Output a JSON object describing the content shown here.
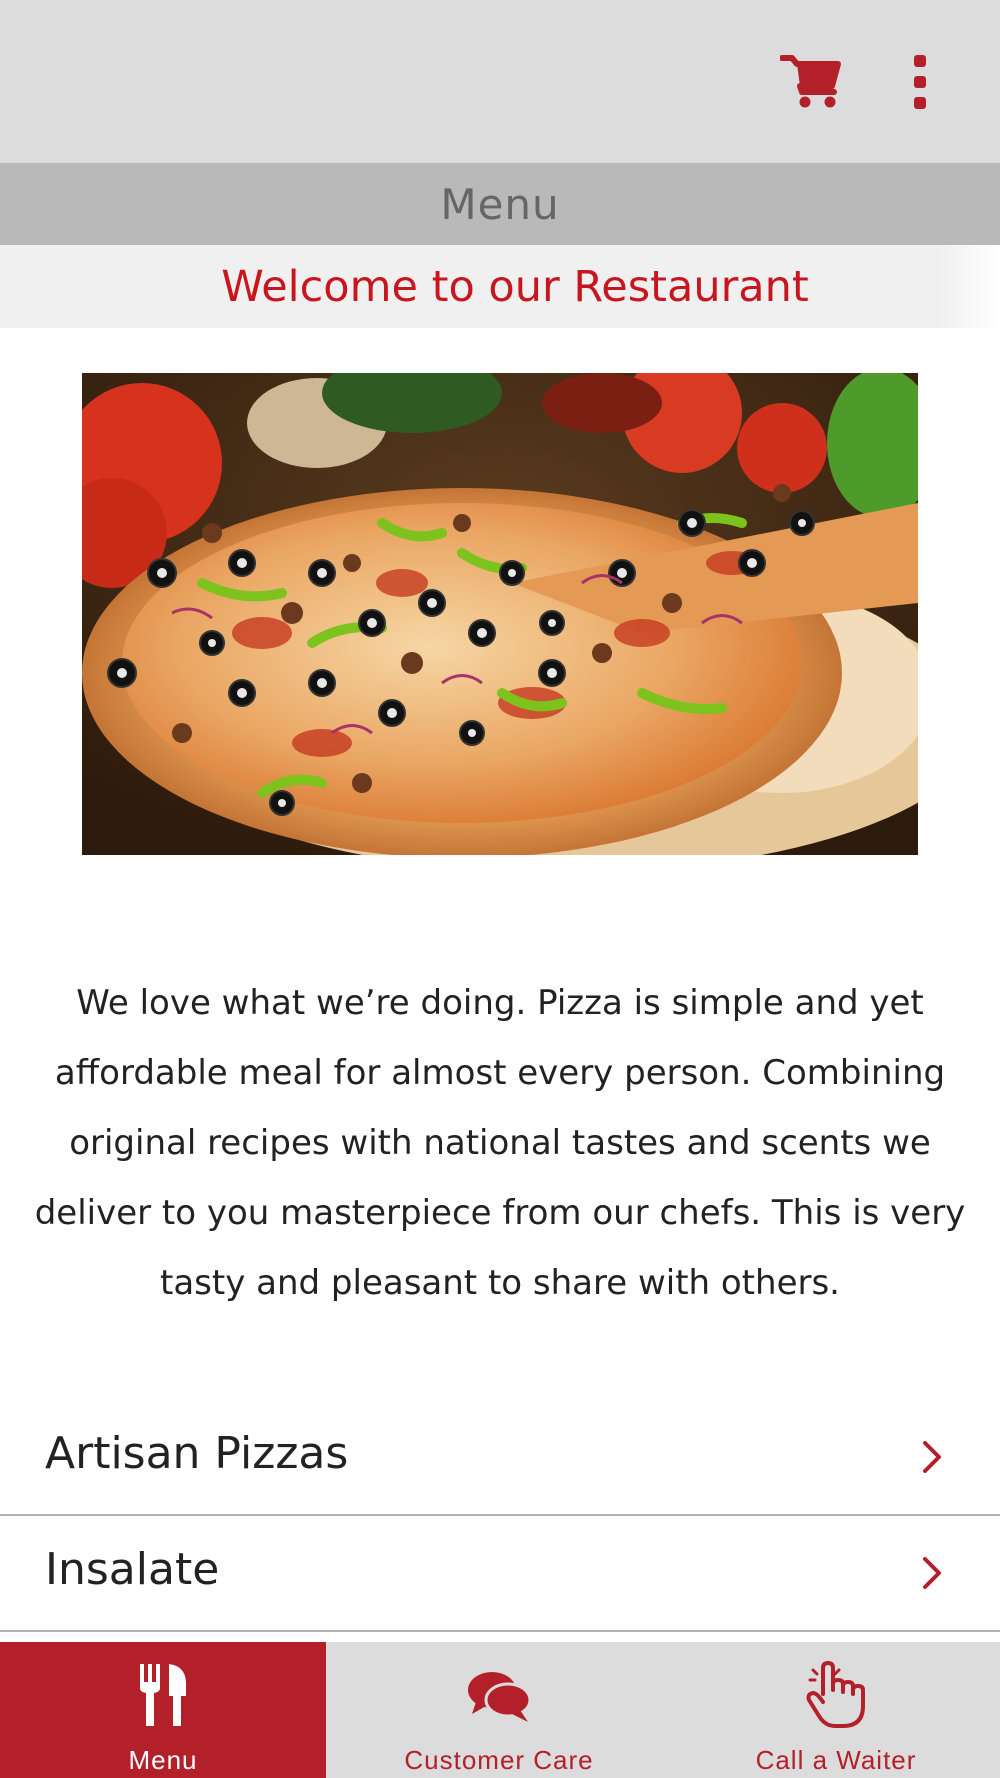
{
  "appbar": {
    "cart_icon": "shopping-cart-icon",
    "more_icon": "more-vertical-icon"
  },
  "header": {
    "title": "Menu"
  },
  "welcome": {
    "text": "Welcome to our Restaurant"
  },
  "hero": {
    "image": "pizza-photo"
  },
  "description": "We love what we’re doing. Pizza is simple and yet affordable meal for almost every person. Combining original recipes with national tastes and scents we deliver to you masterpiece from our chefs. This is very tasty and pleasant to share with others.",
  "categories": [
    {
      "label": "Artisan Pizzas"
    },
    {
      "label": "Insalate"
    }
  ],
  "tabs": [
    {
      "label": "Menu",
      "icon": "fork-knife-icon",
      "active": true
    },
    {
      "label": "Customer Care",
      "icon": "chat-bubbles-icon",
      "active": false
    },
    {
      "label": "Call a Waiter",
      "icon": "pointing-hand-icon",
      "active": false
    }
  ],
  "colors": {
    "accent": "#b3202a",
    "welcome_text": "#c8161e",
    "appbar_bg": "#dcdcdc",
    "titlebar_bg": "#b9b9b9"
  }
}
